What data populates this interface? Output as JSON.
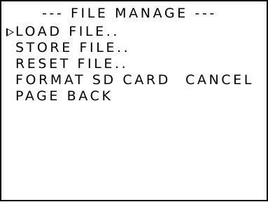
{
  "title": "--- FILE MANAGE ---",
  "menu": {
    "items": [
      {
        "label": "LOAD FILE..",
        "selected": true
      },
      {
        "label": "STORE FILE..",
        "selected": false
      },
      {
        "label": "RESET FILE..",
        "selected": false
      },
      {
        "label": "FORMAT SD CARD",
        "secondary": "CANCEL",
        "selected": false
      },
      {
        "label": "PAGE BACK",
        "selected": false
      }
    ]
  },
  "colors": {
    "foreground": "#000000",
    "background": "#ffffff"
  },
  "icons": {
    "cursor": "selection-cursor-icon"
  }
}
